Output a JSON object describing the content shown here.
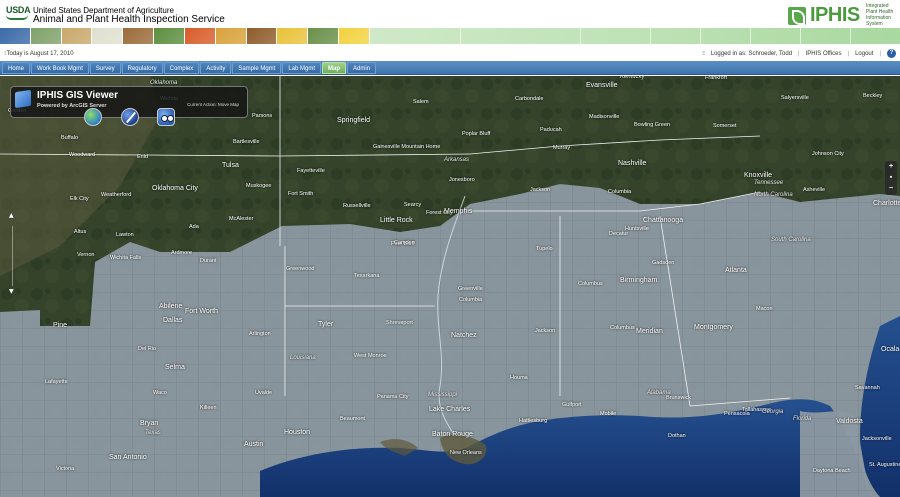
{
  "header": {
    "usda_mark": "USDA",
    "department": "United States Department of Agriculture",
    "agency": "Animal and Plant Health Inspection Service",
    "product_name": "IPHIS",
    "product_full": [
      "Integrated",
      "Plant Health",
      "Information",
      "System"
    ],
    "photo_colors": [
      "#3a6aa8",
      "#7fa16a",
      "#c9a86b",
      "#e0e0d0",
      "#9b6b3a",
      "#5c8e3f",
      "#d85c2a",
      "#d9a23a",
      "#8e5c2b",
      "#e9c23a",
      "#6a8f4a",
      "#f2d23f"
    ]
  },
  "status": {
    "date_text": "Today is August 17, 2010",
    "login_text": "Logged in as: Schroeder, Todd",
    "offices_link": "IPHIS Offices",
    "logout_link": "Logout",
    "help_label": "?"
  },
  "nav": {
    "tabs": [
      {
        "label": "Home",
        "active": false
      },
      {
        "label": "Work Book Mgmt",
        "active": false
      },
      {
        "label": "Survey",
        "active": false
      },
      {
        "label": "Regulatory",
        "active": false
      },
      {
        "label": "Complex",
        "active": false
      },
      {
        "label": "Activity",
        "active": false
      },
      {
        "label": "Sample Mgmt",
        "active": false
      },
      {
        "label": "Lab Mgmt",
        "active": false
      },
      {
        "label": "Map",
        "active": true
      },
      {
        "label": "Admin",
        "active": false
      }
    ]
  },
  "gis_viewer": {
    "title": "IPHIS GIS Viewer",
    "powered_by": "Powered by ArcGIS Server",
    "current_action": "Current Action: Move Map"
  },
  "map_controls": {
    "zoom_in": "+",
    "zoom_out": "−",
    "pan_up": "▲",
    "pan_down": "▼"
  },
  "map_labels": {
    "cities": [
      "Wichita",
      "Parsons",
      "Bartlesville",
      "Garden",
      "Buffalo",
      "Woodward",
      "Enid",
      "Tulsa",
      "Muskogee",
      "Oklahoma City",
      "Weatherford",
      "Elk City",
      "McAlester",
      "Altus",
      "Lawton",
      "Ada",
      "Ardmore",
      "Wichita Falls",
      "Vernon",
      "Durant",
      "Springfield",
      "Salem",
      "Carbondale",
      "Evansville",
      "Frankfort",
      "Salyersville",
      "Beckley",
      "Madisonville",
      "Bowling Green",
      "Somerset",
      "Paducah",
      "Murray",
      "Poplar Bluff",
      "Gainesville Mountain Home",
      "Fayetteville",
      "Fort Smith",
      "Russellville",
      "Searcy",
      "Jonesboro",
      "Little Rock",
      "Forest City",
      "Memphis",
      "Pine Bluff",
      "Nashville",
      "Columbia",
      "Jackson",
      "Knoxville",
      "Johnson City",
      "Asheville",
      "Charlotte",
      "Chattanooga",
      "Huntsville",
      "Decatur",
      "Tupelo",
      "Columbus",
      "Gadsden",
      "Greenville",
      "Atlanta",
      "Birmingham",
      "Macon",
      "Columbia",
      "Greenwood",
      "Texarkana",
      "Camden",
      "Pine",
      "Abilene",
      "Fort Worth",
      "Dallas",
      "Arlington",
      "Tyler",
      "Shreveport",
      "West Monroe",
      "Natchez",
      "Jackson",
      "Meridian",
      "Montgomery",
      "Columbus",
      "Selma",
      "Waco",
      "Killeen",
      "Bryan",
      "Austin",
      "San Antonio",
      "Houston",
      "Beaumont",
      "Lake Charles",
      "Baton Rouge",
      "New Orleans",
      "Houma",
      "Hattiesburg",
      "Gulfport",
      "Mobile",
      "Pensacola",
      "Tallahassee",
      "Valdosta",
      "Jacksonville",
      "St. Augustine",
      "Daytona Beach",
      "Ocala",
      "Savannah",
      "Brunswick",
      "Dothan",
      "Panama City",
      "Lafayette",
      "Victoria",
      "Del Rio",
      "Uvalde",
      "Seguin",
      "Lufkin"
    ],
    "states": [
      "Arkansas",
      "Tennessee",
      "North Carolina",
      "South Carolina",
      "Mississippi",
      "Alabama",
      "Louisiana",
      "Texas",
      "Georgia",
      "Florida",
      "Oklahoma",
      "Kentucky"
    ]
  },
  "colors": {
    "nav_blue": "#3d73ad",
    "active_tab_green": "#6fb05c",
    "map_land_dark": "#34412a",
    "map_land_overlay": "#8e9aa3",
    "water": "#1b3f7a"
  }
}
